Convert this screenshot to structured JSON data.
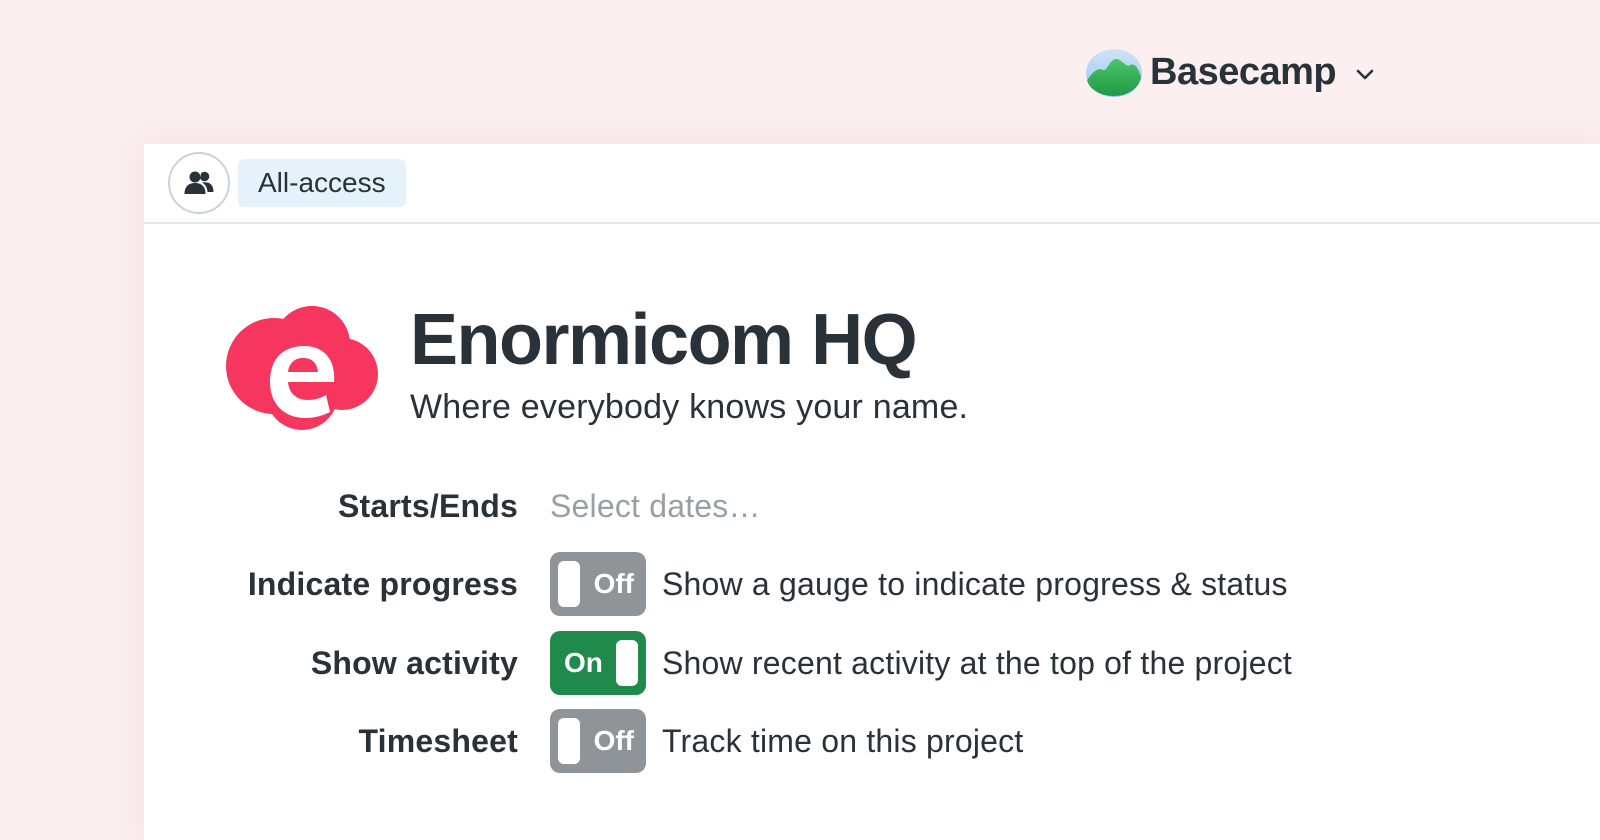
{
  "brand": {
    "name": "Basecamp",
    "logo_icon": "basecamp-mountain-icon",
    "menu_icon": "chevron-down-icon"
  },
  "header": {
    "people_icon": "people-icon",
    "access_label": "All-access"
  },
  "project": {
    "logo_icon": "enormicom-cloud-logo",
    "logo_letter": "e",
    "title": "Enormicom HQ",
    "subtitle": "Where everybody knows your name."
  },
  "settings": {
    "dates": {
      "label": "Starts/Ends",
      "placeholder": "Select dates…"
    },
    "rows": [
      {
        "label": "Indicate progress",
        "state": "Off",
        "description": "Show a gauge to indicate progress & status"
      },
      {
        "label": "Show activity",
        "state": "On",
        "description": "Show recent activity at the top of the project"
      },
      {
        "label": "Timesheet",
        "state": "Off",
        "description": "Track time on this project"
      }
    ]
  },
  "colors": {
    "page_background": "#fbefef",
    "text": "#283238",
    "toggle_off": "#8f9498",
    "toggle_on": "#1f8a4c",
    "badge_background": "#e5f1fb",
    "logo_red": "#f6365f",
    "placeholder": "#9a9fa4"
  }
}
